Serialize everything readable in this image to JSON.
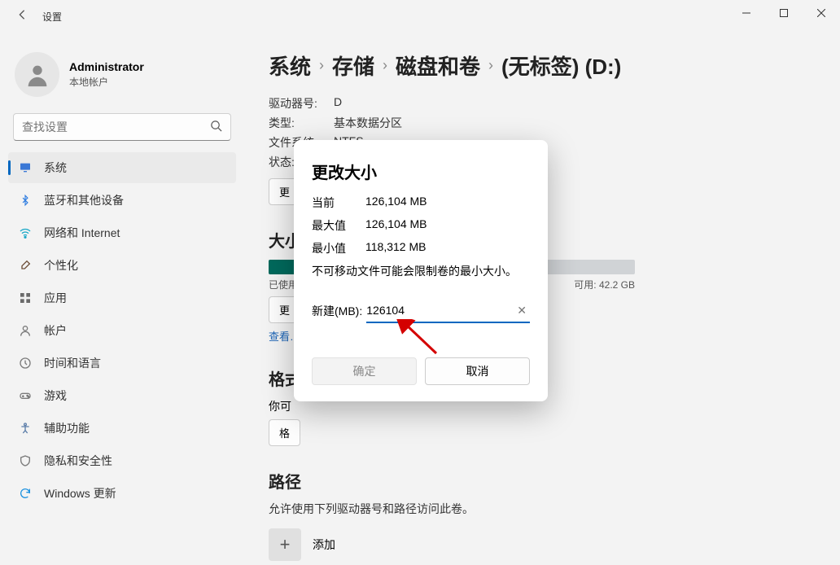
{
  "window": {
    "title": "设置"
  },
  "user": {
    "name": "Administrator",
    "sub": "本地帐户"
  },
  "search": {
    "placeholder": "查找设置"
  },
  "nav": [
    {
      "key": "system",
      "label": "系统",
      "icon": "monitor",
      "color": "#3a78d6",
      "active": true
    },
    {
      "key": "bt",
      "label": "蓝牙和其他设备",
      "icon": "bluetooth",
      "color": "#2f7de0"
    },
    {
      "key": "net",
      "label": "网络和 Internet",
      "icon": "wifi",
      "color": "#1aa8c7"
    },
    {
      "key": "person",
      "label": "个性化",
      "icon": "brush",
      "color": "#6e4f3a"
    },
    {
      "key": "apps",
      "label": "应用",
      "icon": "apps",
      "color": "#6a6a6a"
    },
    {
      "key": "account",
      "label": "帐户",
      "icon": "person",
      "color": "#7a7a7a"
    },
    {
      "key": "time",
      "label": "时间和语言",
      "icon": "clock",
      "color": "#7a7a7a"
    },
    {
      "key": "game",
      "label": "游戏",
      "icon": "gamepad",
      "color": "#7a7a7a"
    },
    {
      "key": "access",
      "label": "辅助功能",
      "icon": "access",
      "color": "#5a7ca8"
    },
    {
      "key": "privacy",
      "label": "隐私和安全性",
      "icon": "shield",
      "color": "#7a7a7a"
    },
    {
      "key": "update",
      "label": "Windows 更新",
      "icon": "update",
      "color": "#1f93e0"
    }
  ],
  "breadcrumb": {
    "a": "系统",
    "b": "存储",
    "c": "磁盘和卷",
    "d": "(无标签) (D:)"
  },
  "props": {
    "drive_label": "驱动器号:",
    "drive_value": "D",
    "type_label": "类型:",
    "type_value": "基本数据分区",
    "fs_label": "文件系统:",
    "fs_value": "NTFS",
    "state_label": "状态:",
    "change_btn": "更"
  },
  "size_section": {
    "heading": "大小",
    "used_label": "已使用",
    "available_label": "可用: 42.2 GB",
    "change_btn": "更",
    "fill_pct": 8,
    "detail_link": "查看…"
  },
  "format_section": {
    "heading": "格式",
    "you_can": "你可",
    "fmt_btn": "格"
  },
  "path_section": {
    "heading": "路径",
    "desc": "允许使用下列驱动器号和路径访问此卷。",
    "add": "添加"
  },
  "dialog": {
    "title": "更改大小",
    "current_label": "当前",
    "current_value": "126,104 MB",
    "max_label": "最大值",
    "max_value": "126,104 MB",
    "min_label": "最小值",
    "min_value": "118,312 MB",
    "note": "不可移动文件可能会限制卷的最小大小。",
    "new_label": "新建(MB):",
    "new_value": "126104",
    "ok": "确定",
    "cancel": "取消"
  }
}
